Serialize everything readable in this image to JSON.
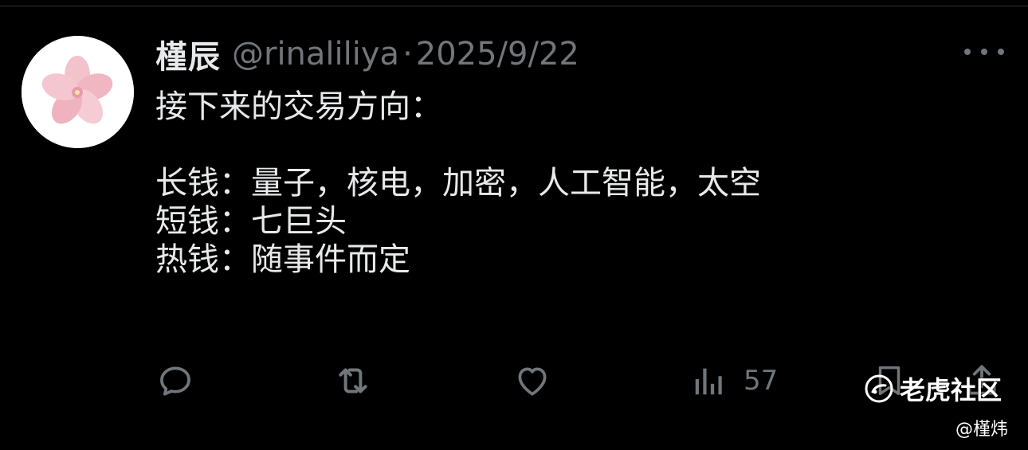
{
  "author": {
    "display_name": "槿辰",
    "handle": "@rinaliliya",
    "separator": "·",
    "date": "2025/9/22"
  },
  "tweet": {
    "lines": [
      "接下来的交易方向：",
      "",
      "长钱：量子，核电，加密，人工智能，太空",
      "短钱：七巨头",
      "热钱：随事件而定"
    ]
  },
  "actions": {
    "reply_icon": "reply-icon",
    "retweet_icon": "retweet-icon",
    "like_icon": "heart-icon",
    "views_icon": "views-bar-chart-icon",
    "views_count": "57",
    "bookmark_icon": "bookmark-icon",
    "share_icon": "share-icon"
  },
  "watermark": {
    "brand": "老虎社区",
    "credit": "@槿炜"
  },
  "colors": {
    "background": "#000000",
    "primary_text": "#e7e9ea",
    "secondary_text": "#71767b"
  }
}
